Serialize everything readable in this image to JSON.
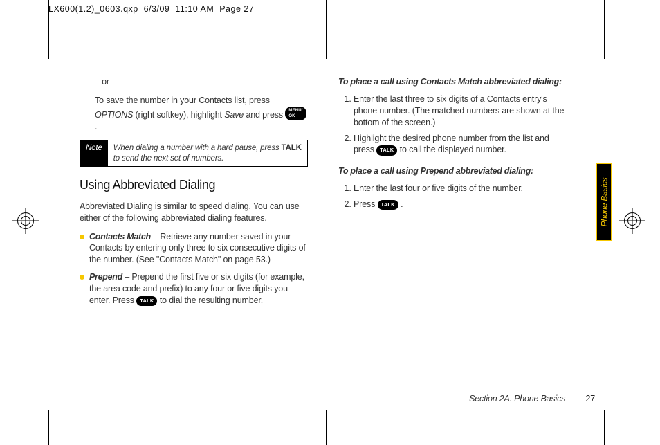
{
  "filestamp": "LX600(1.2)_0603.qxp  6/3/09  11:10 AM  Page 27",
  "left": {
    "or": "– or –",
    "save_para_a": "To save the number in your Contacts list, press ",
    "save_para_b": " (right softkey), highlight ",
    "save_para_c": " and press ",
    "save_para_d": ".",
    "options_label": "OPTIONS",
    "save_label": "Save",
    "ok_key": "OK",
    "note_label": "Note",
    "note_text_a": "When dialing a number with a hard pause, press ",
    "note_text_bold": "TALK",
    "note_text_b": " to send the next set of numbers.",
    "section_title": "Using Abbreviated Dialing",
    "intro": "Abbreviated Dialing is similar to speed dialing. You can use either of the following abbreviated dialing features.",
    "bullet1_lead": "Contacts Match",
    "bullet1": " – Retrieve any number saved in your Contacts by entering only three to six consecutive digits of the number. (See \"Contacts Match\" on page 53.)",
    "bullet2_lead": "Prepend",
    "bullet2_a": " – Prepend the first five or six digits (for example, the area code and prefix) to any four or five digits you enter. Press ",
    "bullet2_b": " to dial the resulting number.",
    "talk_key": "TALK"
  },
  "right": {
    "sub1": "To place a call using Contacts Match abbreviated dialing:",
    "s1_1": "Enter the last three to six digits of a Contacts entry's phone number. (The matched numbers are shown at the bottom of the screen.)",
    "s1_2a": "Highlight the desired phone number from the list and press ",
    "s1_2b": " to call the displayed number.",
    "sub2": "To place a call using Prepend abbreviated dialing:",
    "s2_1": "Enter the last four or five digits of the number.",
    "s2_2a": "Press ",
    "s2_2b": ".",
    "talk_key": "TALK"
  },
  "sidetab": "Phone Basics",
  "footer_section": "Section 2A. Phone Basics",
  "footer_page": "27"
}
